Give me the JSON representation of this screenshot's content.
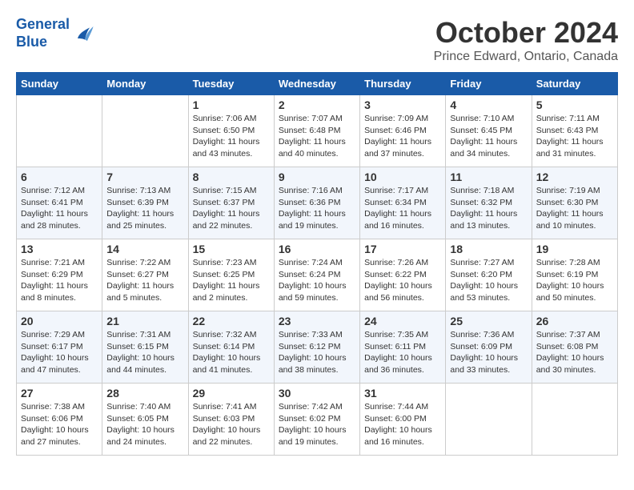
{
  "header": {
    "logo_line1": "General",
    "logo_line2": "Blue",
    "month": "October 2024",
    "location": "Prince Edward, Ontario, Canada"
  },
  "days_of_week": [
    "Sunday",
    "Monday",
    "Tuesday",
    "Wednesday",
    "Thursday",
    "Friday",
    "Saturday"
  ],
  "weeks": [
    [
      {
        "day": "",
        "info": ""
      },
      {
        "day": "",
        "info": ""
      },
      {
        "day": "1",
        "info": "Sunrise: 7:06 AM\nSunset: 6:50 PM\nDaylight: 11 hours and 43 minutes."
      },
      {
        "day": "2",
        "info": "Sunrise: 7:07 AM\nSunset: 6:48 PM\nDaylight: 11 hours and 40 minutes."
      },
      {
        "day": "3",
        "info": "Sunrise: 7:09 AM\nSunset: 6:46 PM\nDaylight: 11 hours and 37 minutes."
      },
      {
        "day": "4",
        "info": "Sunrise: 7:10 AM\nSunset: 6:45 PM\nDaylight: 11 hours and 34 minutes."
      },
      {
        "day": "5",
        "info": "Sunrise: 7:11 AM\nSunset: 6:43 PM\nDaylight: 11 hours and 31 minutes."
      }
    ],
    [
      {
        "day": "6",
        "info": "Sunrise: 7:12 AM\nSunset: 6:41 PM\nDaylight: 11 hours and 28 minutes."
      },
      {
        "day": "7",
        "info": "Sunrise: 7:13 AM\nSunset: 6:39 PM\nDaylight: 11 hours and 25 minutes."
      },
      {
        "day": "8",
        "info": "Sunrise: 7:15 AM\nSunset: 6:37 PM\nDaylight: 11 hours and 22 minutes."
      },
      {
        "day": "9",
        "info": "Sunrise: 7:16 AM\nSunset: 6:36 PM\nDaylight: 11 hours and 19 minutes."
      },
      {
        "day": "10",
        "info": "Sunrise: 7:17 AM\nSunset: 6:34 PM\nDaylight: 11 hours and 16 minutes."
      },
      {
        "day": "11",
        "info": "Sunrise: 7:18 AM\nSunset: 6:32 PM\nDaylight: 11 hours and 13 minutes."
      },
      {
        "day": "12",
        "info": "Sunrise: 7:19 AM\nSunset: 6:30 PM\nDaylight: 11 hours and 10 minutes."
      }
    ],
    [
      {
        "day": "13",
        "info": "Sunrise: 7:21 AM\nSunset: 6:29 PM\nDaylight: 11 hours and 8 minutes."
      },
      {
        "day": "14",
        "info": "Sunrise: 7:22 AM\nSunset: 6:27 PM\nDaylight: 11 hours and 5 minutes."
      },
      {
        "day": "15",
        "info": "Sunrise: 7:23 AM\nSunset: 6:25 PM\nDaylight: 11 hours and 2 minutes."
      },
      {
        "day": "16",
        "info": "Sunrise: 7:24 AM\nSunset: 6:24 PM\nDaylight: 10 hours and 59 minutes."
      },
      {
        "day": "17",
        "info": "Sunrise: 7:26 AM\nSunset: 6:22 PM\nDaylight: 10 hours and 56 minutes."
      },
      {
        "day": "18",
        "info": "Sunrise: 7:27 AM\nSunset: 6:20 PM\nDaylight: 10 hours and 53 minutes."
      },
      {
        "day": "19",
        "info": "Sunrise: 7:28 AM\nSunset: 6:19 PM\nDaylight: 10 hours and 50 minutes."
      }
    ],
    [
      {
        "day": "20",
        "info": "Sunrise: 7:29 AM\nSunset: 6:17 PM\nDaylight: 10 hours and 47 minutes."
      },
      {
        "day": "21",
        "info": "Sunrise: 7:31 AM\nSunset: 6:15 PM\nDaylight: 10 hours and 44 minutes."
      },
      {
        "day": "22",
        "info": "Sunrise: 7:32 AM\nSunset: 6:14 PM\nDaylight: 10 hours and 41 minutes."
      },
      {
        "day": "23",
        "info": "Sunrise: 7:33 AM\nSunset: 6:12 PM\nDaylight: 10 hours and 38 minutes."
      },
      {
        "day": "24",
        "info": "Sunrise: 7:35 AM\nSunset: 6:11 PM\nDaylight: 10 hours and 36 minutes."
      },
      {
        "day": "25",
        "info": "Sunrise: 7:36 AM\nSunset: 6:09 PM\nDaylight: 10 hours and 33 minutes."
      },
      {
        "day": "26",
        "info": "Sunrise: 7:37 AM\nSunset: 6:08 PM\nDaylight: 10 hours and 30 minutes."
      }
    ],
    [
      {
        "day": "27",
        "info": "Sunrise: 7:38 AM\nSunset: 6:06 PM\nDaylight: 10 hours and 27 minutes."
      },
      {
        "day": "28",
        "info": "Sunrise: 7:40 AM\nSunset: 6:05 PM\nDaylight: 10 hours and 24 minutes."
      },
      {
        "day": "29",
        "info": "Sunrise: 7:41 AM\nSunset: 6:03 PM\nDaylight: 10 hours and 22 minutes."
      },
      {
        "day": "30",
        "info": "Sunrise: 7:42 AM\nSunset: 6:02 PM\nDaylight: 10 hours and 19 minutes."
      },
      {
        "day": "31",
        "info": "Sunrise: 7:44 AM\nSunset: 6:00 PM\nDaylight: 10 hours and 16 minutes."
      },
      {
        "day": "",
        "info": ""
      },
      {
        "day": "",
        "info": ""
      }
    ]
  ]
}
